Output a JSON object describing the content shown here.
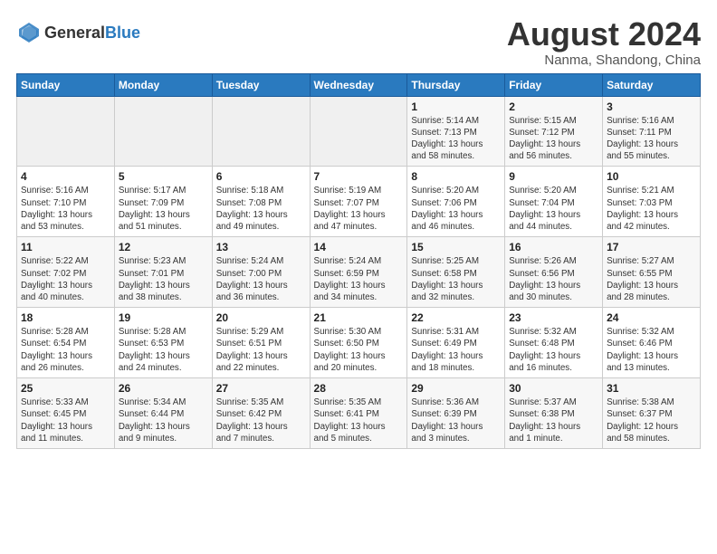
{
  "header": {
    "logo_general": "General",
    "logo_blue": "Blue",
    "month_title": "August 2024",
    "location": "Nanma, Shandong, China"
  },
  "weekdays": [
    "Sunday",
    "Monday",
    "Tuesday",
    "Wednesday",
    "Thursday",
    "Friday",
    "Saturday"
  ],
  "weeks": [
    [
      {
        "day": "",
        "info": ""
      },
      {
        "day": "",
        "info": ""
      },
      {
        "day": "",
        "info": ""
      },
      {
        "day": "",
        "info": ""
      },
      {
        "day": "1",
        "info": "Sunrise: 5:14 AM\nSunset: 7:13 PM\nDaylight: 13 hours\nand 58 minutes."
      },
      {
        "day": "2",
        "info": "Sunrise: 5:15 AM\nSunset: 7:12 PM\nDaylight: 13 hours\nand 56 minutes."
      },
      {
        "day": "3",
        "info": "Sunrise: 5:16 AM\nSunset: 7:11 PM\nDaylight: 13 hours\nand 55 minutes."
      }
    ],
    [
      {
        "day": "4",
        "info": "Sunrise: 5:16 AM\nSunset: 7:10 PM\nDaylight: 13 hours\nand 53 minutes."
      },
      {
        "day": "5",
        "info": "Sunrise: 5:17 AM\nSunset: 7:09 PM\nDaylight: 13 hours\nand 51 minutes."
      },
      {
        "day": "6",
        "info": "Sunrise: 5:18 AM\nSunset: 7:08 PM\nDaylight: 13 hours\nand 49 minutes."
      },
      {
        "day": "7",
        "info": "Sunrise: 5:19 AM\nSunset: 7:07 PM\nDaylight: 13 hours\nand 47 minutes."
      },
      {
        "day": "8",
        "info": "Sunrise: 5:20 AM\nSunset: 7:06 PM\nDaylight: 13 hours\nand 46 minutes."
      },
      {
        "day": "9",
        "info": "Sunrise: 5:20 AM\nSunset: 7:04 PM\nDaylight: 13 hours\nand 44 minutes."
      },
      {
        "day": "10",
        "info": "Sunrise: 5:21 AM\nSunset: 7:03 PM\nDaylight: 13 hours\nand 42 minutes."
      }
    ],
    [
      {
        "day": "11",
        "info": "Sunrise: 5:22 AM\nSunset: 7:02 PM\nDaylight: 13 hours\nand 40 minutes."
      },
      {
        "day": "12",
        "info": "Sunrise: 5:23 AM\nSunset: 7:01 PM\nDaylight: 13 hours\nand 38 minutes."
      },
      {
        "day": "13",
        "info": "Sunrise: 5:24 AM\nSunset: 7:00 PM\nDaylight: 13 hours\nand 36 minutes."
      },
      {
        "day": "14",
        "info": "Sunrise: 5:24 AM\nSunset: 6:59 PM\nDaylight: 13 hours\nand 34 minutes."
      },
      {
        "day": "15",
        "info": "Sunrise: 5:25 AM\nSunset: 6:58 PM\nDaylight: 13 hours\nand 32 minutes."
      },
      {
        "day": "16",
        "info": "Sunrise: 5:26 AM\nSunset: 6:56 PM\nDaylight: 13 hours\nand 30 minutes."
      },
      {
        "day": "17",
        "info": "Sunrise: 5:27 AM\nSunset: 6:55 PM\nDaylight: 13 hours\nand 28 minutes."
      }
    ],
    [
      {
        "day": "18",
        "info": "Sunrise: 5:28 AM\nSunset: 6:54 PM\nDaylight: 13 hours\nand 26 minutes."
      },
      {
        "day": "19",
        "info": "Sunrise: 5:28 AM\nSunset: 6:53 PM\nDaylight: 13 hours\nand 24 minutes."
      },
      {
        "day": "20",
        "info": "Sunrise: 5:29 AM\nSunset: 6:51 PM\nDaylight: 13 hours\nand 22 minutes."
      },
      {
        "day": "21",
        "info": "Sunrise: 5:30 AM\nSunset: 6:50 PM\nDaylight: 13 hours\nand 20 minutes."
      },
      {
        "day": "22",
        "info": "Sunrise: 5:31 AM\nSunset: 6:49 PM\nDaylight: 13 hours\nand 18 minutes."
      },
      {
        "day": "23",
        "info": "Sunrise: 5:32 AM\nSunset: 6:48 PM\nDaylight: 13 hours\nand 16 minutes."
      },
      {
        "day": "24",
        "info": "Sunrise: 5:32 AM\nSunset: 6:46 PM\nDaylight: 13 hours\nand 13 minutes."
      }
    ],
    [
      {
        "day": "25",
        "info": "Sunrise: 5:33 AM\nSunset: 6:45 PM\nDaylight: 13 hours\nand 11 minutes."
      },
      {
        "day": "26",
        "info": "Sunrise: 5:34 AM\nSunset: 6:44 PM\nDaylight: 13 hours\nand 9 minutes."
      },
      {
        "day": "27",
        "info": "Sunrise: 5:35 AM\nSunset: 6:42 PM\nDaylight: 13 hours\nand 7 minutes."
      },
      {
        "day": "28",
        "info": "Sunrise: 5:35 AM\nSunset: 6:41 PM\nDaylight: 13 hours\nand 5 minutes."
      },
      {
        "day": "29",
        "info": "Sunrise: 5:36 AM\nSunset: 6:39 PM\nDaylight: 13 hours\nand 3 minutes."
      },
      {
        "day": "30",
        "info": "Sunrise: 5:37 AM\nSunset: 6:38 PM\nDaylight: 13 hours\nand 1 minute."
      },
      {
        "day": "31",
        "info": "Sunrise: 5:38 AM\nSunset: 6:37 PM\nDaylight: 12 hours\nand 58 minutes."
      }
    ]
  ]
}
